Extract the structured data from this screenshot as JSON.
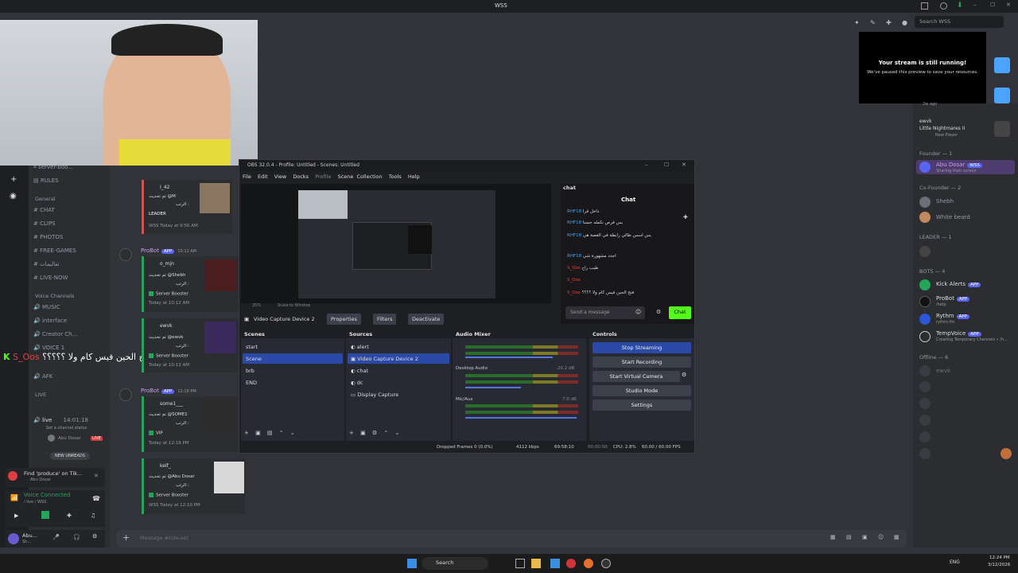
{
  "app": {
    "title": "WSS",
    "search_placeholder": "Search WSS"
  },
  "notice": {
    "title": "Your stream is still running!",
    "body": "We've paused this preview to save your resources."
  },
  "sidebar": {
    "top_channels": [
      "server-boo...",
      "RULES"
    ],
    "cat_general": "General",
    "general_channels": [
      "CHAT",
      "CLIPS",
      "PHOTOS",
      "FREE-GAMES",
      "تعاليمات",
      "LIVE-NOW"
    ],
    "cat_voice": "Voice Channels",
    "voice_channels": [
      "MUSIC",
      "interface",
      "Creator Ch...",
      "VOICE 1",
      "AFK"
    ],
    "cat_live": "LIVE",
    "live_channel": "live",
    "live_time": "14:01:18",
    "live_status": "Set a channel status",
    "live_user": "Abu Dosar",
    "live_badge": "LIVE",
    "new_unreads": "NEW UNREADS",
    "overlay_name": "S_Oos",
    "overlay_text": "تفتح الحين فيس كام ولا ؟؟؟؟؟",
    "activity_title": "Find 'produce' on Tik...",
    "activity_sub": "Abu Dosar",
    "voice_connected": "Voice Connected",
    "voice_sub": "/ live / WSS",
    "user_name": "Abu...",
    "user_status": "Sh..."
  },
  "messages": [
    {
      "title": "I_42",
      "line1": "تم تحديث @M",
      "line2": "الرتب :",
      "role": "LEADER",
      "footer": "WSS Today at 9:56 AM"
    },
    {
      "author": "ProBot",
      "badge": "APP",
      "time": "10:12 AM",
      "title": "o_mjn",
      "line1": "تم تحديث @Shebh",
      "line2": "الرتب :",
      "role": "Server Booster",
      "footer": "Today at 10:12 AM"
    },
    {
      "title": "ewvk",
      "line1": "تم تحديث @ewvk",
      "line2": "الرتب :",
      "role": "Server Booster",
      "footer": "Today at 10:13 AM"
    },
    {
      "author": "ProBot",
      "badge": "APP",
      "time": "12:16 PM",
      "title": "some1___",
      "line1": "تم تحديث @SOME1",
      "line2": "الرتب :",
      "role": "VIP",
      "footer": "Today at 12:16 PM"
    },
    {
      "title": "kelf_",
      "line1": "تم تحديث @Abu Dosar",
      "line2": "الرتب :",
      "role": "Server Booster",
      "footer": "WSS Today at 12:10 PM"
    }
  ],
  "composer_placeholder": "Message #rule-set",
  "obs": {
    "title": "OBS 32.0.4 - Profile: Untitled - Scenes: Untitled",
    "menu": [
      "File",
      "Edit",
      "View",
      "Docks",
      "Profile",
      "Scene Collection",
      "Tools",
      "Help"
    ],
    "zoom": "25%",
    "scale": "Scale to Window",
    "source_bar": {
      "name": "Video Capture Device 2",
      "properties": "Properties",
      "filters": "Filters",
      "deactivate": "Deactivate"
    },
    "scenes_title": "Scenes",
    "scenes": [
      "start",
      "Scene",
      "brb",
      "END"
    ],
    "sources_title": "Sources",
    "sources": [
      "alert",
      "Video Capture Device 2",
      "chat",
      "dc",
      "Display Capture"
    ],
    "mixer_title": "Audio Mixer",
    "mixer": [
      {
        "name": "",
        "db": ""
      },
      {
        "name": "Desktop Audio",
        "db": "-20.2 dB"
      },
      {
        "name": "Mic/Aux",
        "db": "7.0 dB"
      }
    ],
    "controls_title": "Controls",
    "controls": [
      "Stop Streaming",
      "Start Recording",
      "Start Virtual Camera",
      "Studio Mode",
      "Settings"
    ],
    "chat_dock": "chat",
    "chat_header": "Chat",
    "chat_lines": [
      "داخل قرا",
      "بس فرص نكمله حسنا",
      "بس اسس طالي رابطة في القصة هي",
      "اجدد مشهورة شي",
      "طيب راح",
      "",
      "فتح الحين فيس كام ولا ؟؟؟؟"
    ],
    "chat_users": [
      "RHF18",
      "RHF18",
      "RHF18",
      "RHF18",
      "S_Oos",
      "S_Oos",
      "S_Oos"
    ],
    "chat_placeholder": "Send a message",
    "chat_button": "Chat",
    "status": {
      "dropped": "Dropped Frames 0 (0.0%)",
      "kbps": "4112 kbps",
      "rec_time": "69:58:10",
      "idle": "00:00:00",
      "cpu": "CPU: 2.8%",
      "fps": "60.00 / 60.00 FPS"
    }
  },
  "members": {
    "top_user": "ewvk",
    "top_sub": "Little Nightmares II",
    "top_sub2": "New Player",
    "top_ago": "2w ago",
    "groups": [
      {
        "label": "Founder — 1",
        "users": [
          {
            "name": "Abu Dosar",
            "badge": "WSS",
            "sub": "Sharing their screen",
            "color": "#c9a0f0"
          }
        ]
      },
      {
        "label": "Co-Founder — 2",
        "users": [
          {
            "name": "Shebh",
            "badge": "",
            "sub": "",
            "color": "#949ba4"
          },
          {
            "name": "White beard",
            "badge": "",
            "sub": "",
            "color": "#949ba4"
          }
        ]
      },
      {
        "label": "LEADER — 1",
        "users": [
          {
            "name": "",
            "badge": "",
            "sub": "",
            "color": "#949ba4"
          }
        ]
      },
      {
        "label": "BOTS — 4",
        "users": [
          {
            "name": "Kick Alerts",
            "badge": "APP",
            "sub": "",
            "color": "#dbdee1"
          },
          {
            "name": "ProBot",
            "badge": "APP",
            "sub": "/help",
            "color": "#dbdee1"
          },
          {
            "name": "Rythm",
            "badge": "APP",
            "sub": "rythm.fm",
            "color": "#dbdee1"
          },
          {
            "name": "TempVoice",
            "badge": "APP",
            "sub": "Creating Temporary Channels • /h...",
            "color": "#dbdee1"
          }
        ]
      },
      {
        "label": "Offline — 6",
        "users": [
          {
            "name": "ewvk",
            "badge": "",
            "sub": "",
            "color": "#6d6f78"
          }
        ]
      }
    ]
  },
  "taskbar": {
    "search": "Search",
    "lang": "ENG",
    "time": "12:24 PM",
    "date": "3/12/2026"
  }
}
